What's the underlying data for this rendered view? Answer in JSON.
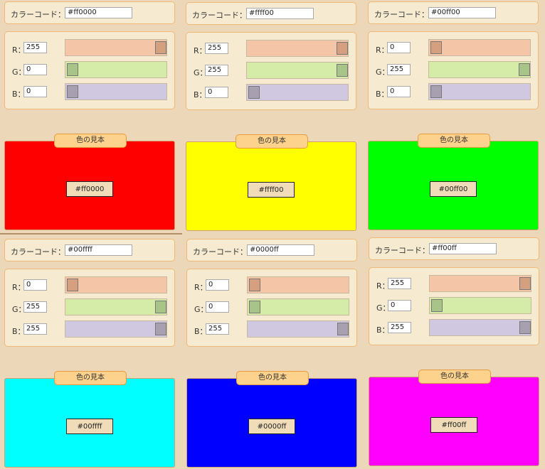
{
  "labels": {
    "hex": "カラーコード：",
    "r": "R：",
    "g": "G：",
    "b": "B：",
    "sample": "色の見本"
  },
  "panels": [
    {
      "hex": "#ff0000",
      "r": "255",
      "g": "0",
      "b": "0",
      "rv": 255,
      "gv": 0,
      "bv": 0
    },
    {
      "hex": "#ffff00",
      "r": "255",
      "g": "255",
      "b": "0",
      "rv": 255,
      "gv": 255,
      "bv": 0
    },
    {
      "hex": "#00ff00",
      "r": "0",
      "g": "255",
      "b": "0",
      "rv": 0,
      "gv": 255,
      "bv": 0
    },
    {
      "hex": "#00ffff",
      "r": "0",
      "g": "255",
      "b": "255",
      "rv": 0,
      "gv": 255,
      "bv": 255
    },
    {
      "hex": "#0000ff",
      "r": "0",
      "g": "0",
      "b": "255",
      "rv": 0,
      "gv": 0,
      "bv": 255
    },
    {
      "hex": "#ff00ff",
      "r": "255",
      "g": "0",
      "b": "255",
      "rv": 255,
      "gv": 0,
      "bv": 255
    }
  ],
  "colors": {
    "r_track": "#f5c5a8",
    "r_thumb": "#d4a080",
    "g_track": "#d4eca8",
    "g_thumb": "#a8c488",
    "b_track": "#d0c8e0",
    "b_thumb": "#a8a0b0"
  }
}
